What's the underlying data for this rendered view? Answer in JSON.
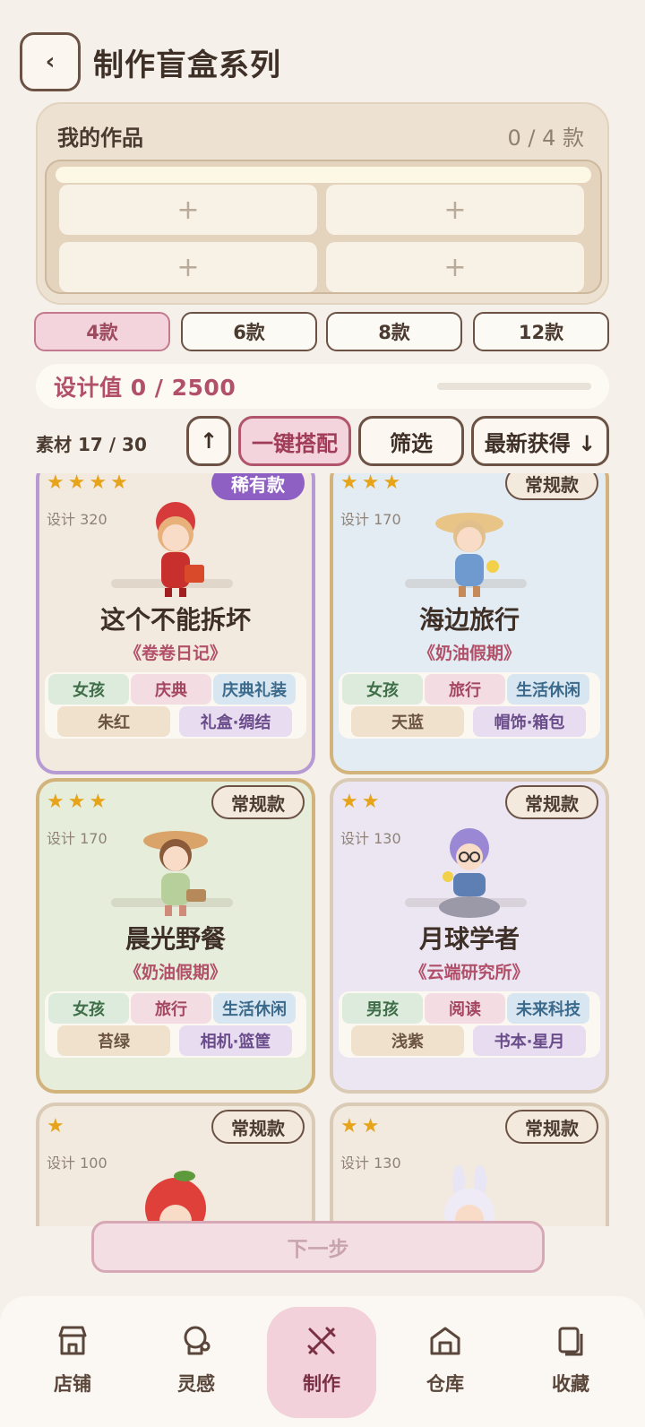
{
  "header": {
    "back_glyph": "‹",
    "title": "制作盲盒系列"
  },
  "works": {
    "title": "我的作品",
    "count": "0 / 4 款",
    "slots": [
      "+",
      "+",
      "+",
      "+"
    ]
  },
  "count_tabs": [
    {
      "label": "4款",
      "active": true
    },
    {
      "label": "6款",
      "active": false
    },
    {
      "label": "8款",
      "active": false
    },
    {
      "label": "12款",
      "active": false
    }
  ],
  "design": {
    "text": "设计值 0 / 2500",
    "progress": 0
  },
  "toolbar": {
    "materials": "素材 17 / 30",
    "sort_up_glyph": "↑",
    "auto_match": "一键搭配",
    "filter": "筛选",
    "sort": "最新获得 ↓"
  },
  "cards": [
    {
      "stars": "★★★★",
      "rarity": "稀有款",
      "design": "设计 320",
      "name": "这个不能拆坏",
      "series": "《卷卷日记》",
      "tags": [
        "女孩",
        "庆典",
        "庆典礼装",
        "朱红",
        "礼盒·绸结"
      ],
      "bg": "#f3eadf",
      "border": "#b69ad3"
    },
    {
      "stars": "★★★",
      "rarity": "常规款",
      "design": "设计 170",
      "name": "海边旅行",
      "series": "《奶油假期》",
      "tags": [
        "女孩",
        "旅行",
        "生活休闲",
        "天蓝",
        "帽饰·箱包"
      ],
      "bg": "#e3ebf3",
      "border": "#d2b37c"
    },
    {
      "stars": "★★★",
      "rarity": "常规款",
      "design": "设计 170",
      "name": "晨光野餐",
      "series": "《奶油假期》",
      "tags": [
        "女孩",
        "旅行",
        "生活休闲",
        "苔绿",
        "相机·篮筐"
      ],
      "bg": "#e6eedb",
      "border": "#d2b37c"
    },
    {
      "stars": "★★",
      "rarity": "常规款",
      "design": "设计 130",
      "name": "月球学者",
      "series": "《云端研究所》",
      "tags": [
        "男孩",
        "阅读",
        "未来科技",
        "浅紫",
        "书本·星月"
      ],
      "bg": "#ebe6f2",
      "border": "#d9cbb6"
    },
    {
      "stars": "★",
      "rarity": "常规款",
      "design": "设计 100",
      "name": "",
      "series": "",
      "tags": [],
      "bg": "#f3eadf",
      "border": "#d9cbb6"
    },
    {
      "stars": "★★",
      "rarity": "常规款",
      "design": "设计 130",
      "name": "",
      "series": "",
      "tags": [],
      "bg": "#f3eadf",
      "border": "#d9cbb6"
    }
  ],
  "next_button": "下一步",
  "nav": [
    {
      "label": "店铺",
      "icon": "store-icon",
      "active": false
    },
    {
      "label": "灵感",
      "icon": "inspiration-icon",
      "active": false
    },
    {
      "label": "制作",
      "icon": "tools-icon",
      "active": true
    },
    {
      "label": "仓库",
      "icon": "warehouse-icon",
      "active": false
    },
    {
      "label": "收藏",
      "icon": "collection-icon",
      "active": false
    }
  ],
  "colors": {
    "accent_pink": "#b2506a",
    "brown": "#6b5245",
    "star": "#e5a41c"
  }
}
